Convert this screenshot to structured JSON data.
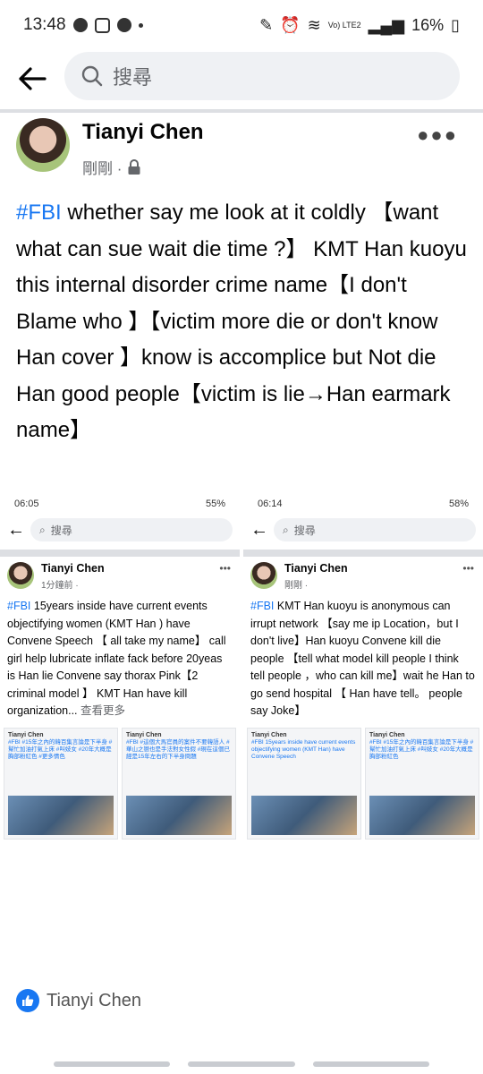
{
  "status_bar": {
    "time": "13:48",
    "battery": "16%",
    "network": "Vo) LTE2"
  },
  "search": {
    "placeholder": "搜尋"
  },
  "post": {
    "author": "Tianyi Chen",
    "time": "剛剛 · ",
    "hashtag": "#FBI",
    "body": " whether say me look at it coldly 【want what can sue  wait die time ?】 KMT Han kuoyu this internal disorder crime  name【I don't  Blame  who 】【victim  more  die or don't know Han cover 】know is accomplice but Not die Han good people【victim  is  lie→Han earmark name】"
  },
  "screenshot1": {
    "time": "06:05",
    "battery": "55%",
    "search_placeholder": "搜尋",
    "author": "Tianyi Chen",
    "meta": "1分鐘前 · ",
    "hashtag": "#FBI",
    "text": " 15years inside have current events objectifying women  (KMT Han ) have Convene Speech 【 all take my name】 call girl  help lubricate inflate fack before 20yeas is Han lie  Convene say thorax Pink【2 criminal  model 】 KMT Han  have kill organization...",
    "see_more": " 查看更多",
    "minis": [
      {
        "name": "Tianyi Chen",
        "text": "#FBI #15年之內的韓百集言論是下半身 #幫忙加油打氣上床 #叫妓女 #20年大概是胸部粉紅色 #更多情色"
      },
      {
        "name": "Tianyi Chen",
        "text": "#FBI #這個大馬官員的案件不要韓語人 #華山之戀也是手法對女性假 #現在這個已經是15年左右的下半身問題"
      }
    ]
  },
  "screenshot2": {
    "time": "06:14",
    "battery": "58%",
    "search_placeholder": "搜尋",
    "author": "Tianyi Chen",
    "meta": "剛剛 · ",
    "hashtag": "#FBI",
    "text": " KMT Han kuoyu is anonymous can irrupt network 【say me ip Location，but I don't  live】Han kuoyu Convene kill die people 【tell what model  kill people I think tell people  ，who can kill me】wait he Han to go send hospital 【 Han have tell。 people  say Joke】",
    "minis": [
      {
        "name": "Tianyi Chen",
        "text": "#FBI 15years inside have current events objectifying women (KMT Han) have Convene Speech"
      },
      {
        "name": "Tianyi Chen",
        "text": "#FBI #15年之內的韓百集言論是下半身 #幫忙加油打氣上床 #叫妓女 #20年大概是胸部粉紅色"
      }
    ]
  },
  "footer": {
    "liker_name": "Tianyi Chen"
  },
  "colors": {
    "accent": "#1877f2",
    "muted": "#65676b",
    "search_bg": "#eff1f4"
  }
}
